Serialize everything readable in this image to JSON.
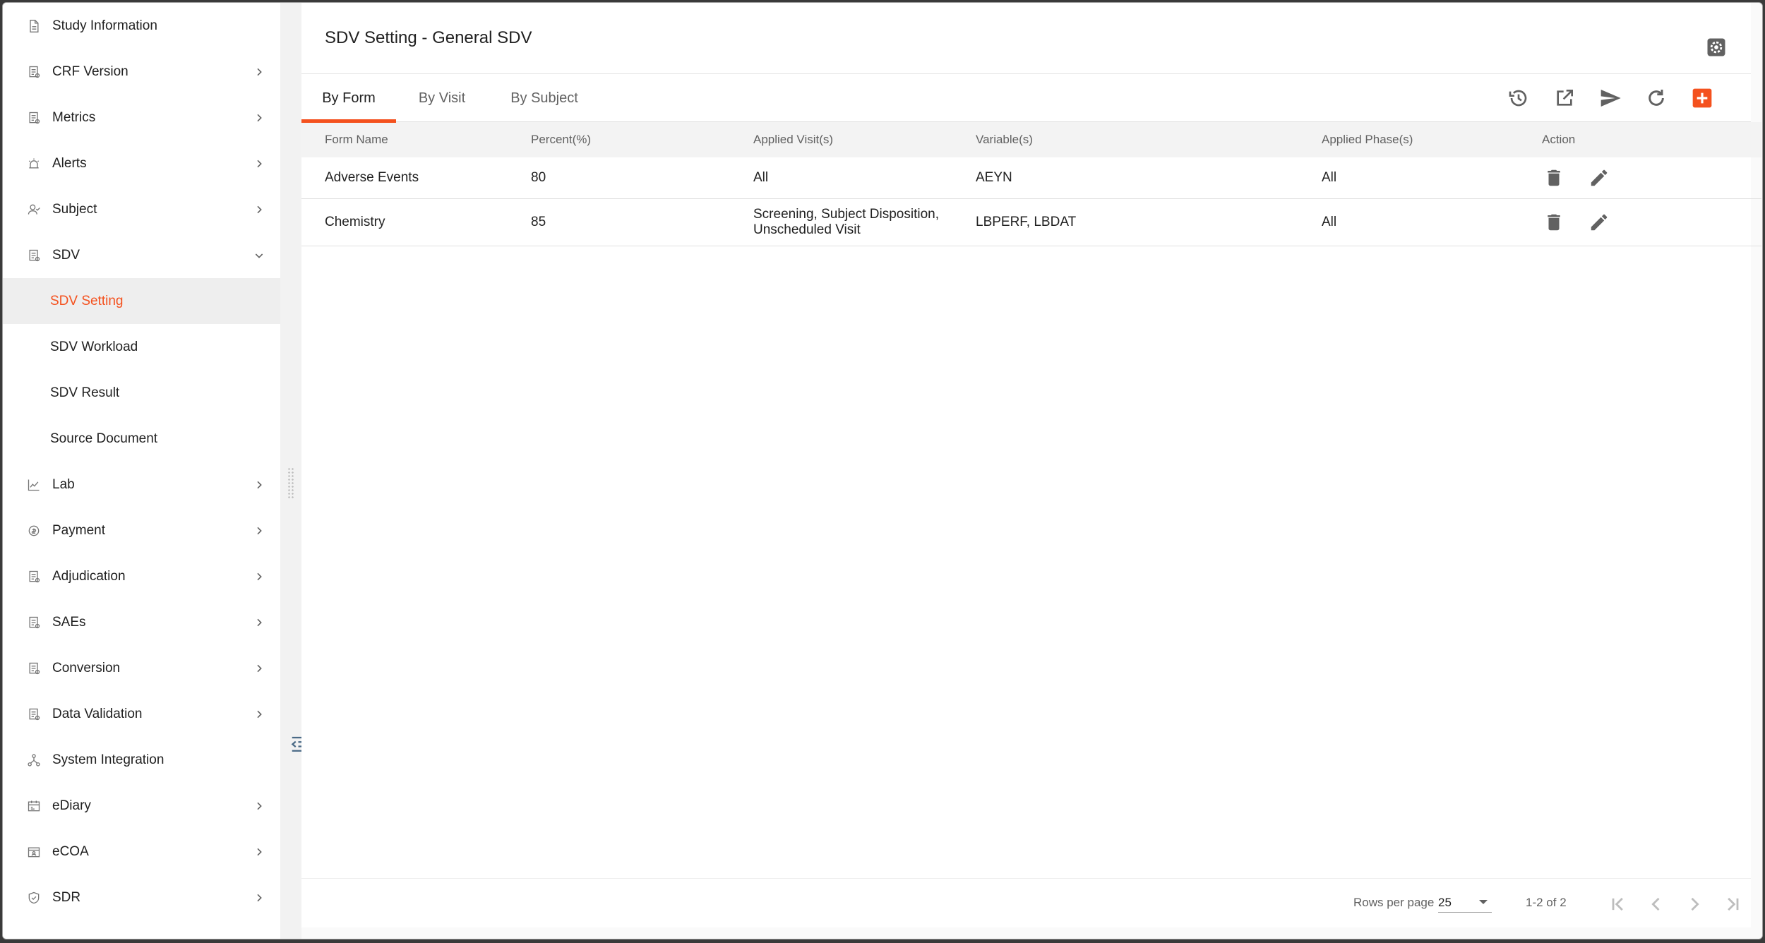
{
  "sidebar": {
    "items": [
      {
        "label": "Study Information",
        "icon": "document-icon",
        "expandable": false
      },
      {
        "label": "CRF Version",
        "icon": "form-icon",
        "expandable": true
      },
      {
        "label": "Metrics",
        "icon": "form-icon",
        "expandable": true
      },
      {
        "label": "Alerts",
        "icon": "alarm-icon",
        "expandable": true
      },
      {
        "label": "Subject",
        "icon": "people-icon",
        "expandable": true
      },
      {
        "label": "SDV",
        "icon": "form-icon",
        "expandable": true,
        "expanded": true
      },
      {
        "label": "Lab",
        "icon": "line-chart-icon",
        "expandable": true
      },
      {
        "label": "Payment",
        "icon": "payment-icon",
        "expandable": true
      },
      {
        "label": "Adjudication",
        "icon": "form-icon",
        "expandable": true
      },
      {
        "label": "SAEs",
        "icon": "form-icon",
        "expandable": true
      },
      {
        "label": "Conversion",
        "icon": "form-icon",
        "expandable": true
      },
      {
        "label": "Data Validation",
        "icon": "form-icon",
        "expandable": true
      },
      {
        "label": "System Integration",
        "icon": "network-icon",
        "expandable": false
      },
      {
        "label": "eDiary",
        "icon": "calendar-icon",
        "expandable": true
      },
      {
        "label": "eCOA",
        "icon": "badge-icon",
        "expandable": true
      },
      {
        "label": "SDR",
        "icon": "shield-icon",
        "expandable": true
      }
    ],
    "sdv_children": [
      {
        "label": "SDV Setting",
        "active": true
      },
      {
        "label": "SDV Workload",
        "active": false
      },
      {
        "label": "SDV Result",
        "active": false
      },
      {
        "label": "Source Document",
        "active": false
      }
    ]
  },
  "header": {
    "title": "SDV Setting - General SDV",
    "settings_icon": "gear-icon"
  },
  "tabs": [
    {
      "label": "By Form",
      "active": true
    },
    {
      "label": "By Visit",
      "active": false
    },
    {
      "label": "By Subject",
      "active": false
    }
  ],
  "toolbar": {
    "icons": [
      "history-icon",
      "open-in-new-icon",
      "send-icon",
      "refresh-icon",
      "add-box-icon"
    ],
    "accent": "#f4511e"
  },
  "table": {
    "columns": [
      "Form Name",
      "Percent(%)",
      "Applied Visit(s)",
      "Variable(s)",
      "Applied Phase(s)",
      "Action"
    ],
    "rows": [
      {
        "form_name": "Adverse Events",
        "percent": "80",
        "visits": "All",
        "variables": "AEYN",
        "phases": "All"
      },
      {
        "form_name": "Chemistry",
        "percent": "85",
        "visits": "Screening, Subject Disposition, Unscheduled Visit",
        "variables": "LBPERF, LBDAT",
        "phases": "All"
      }
    ]
  },
  "pagination": {
    "rows_per_page_label": "Rows per page",
    "rows_per_page_value": "25",
    "range": "1-2 of 2"
  }
}
